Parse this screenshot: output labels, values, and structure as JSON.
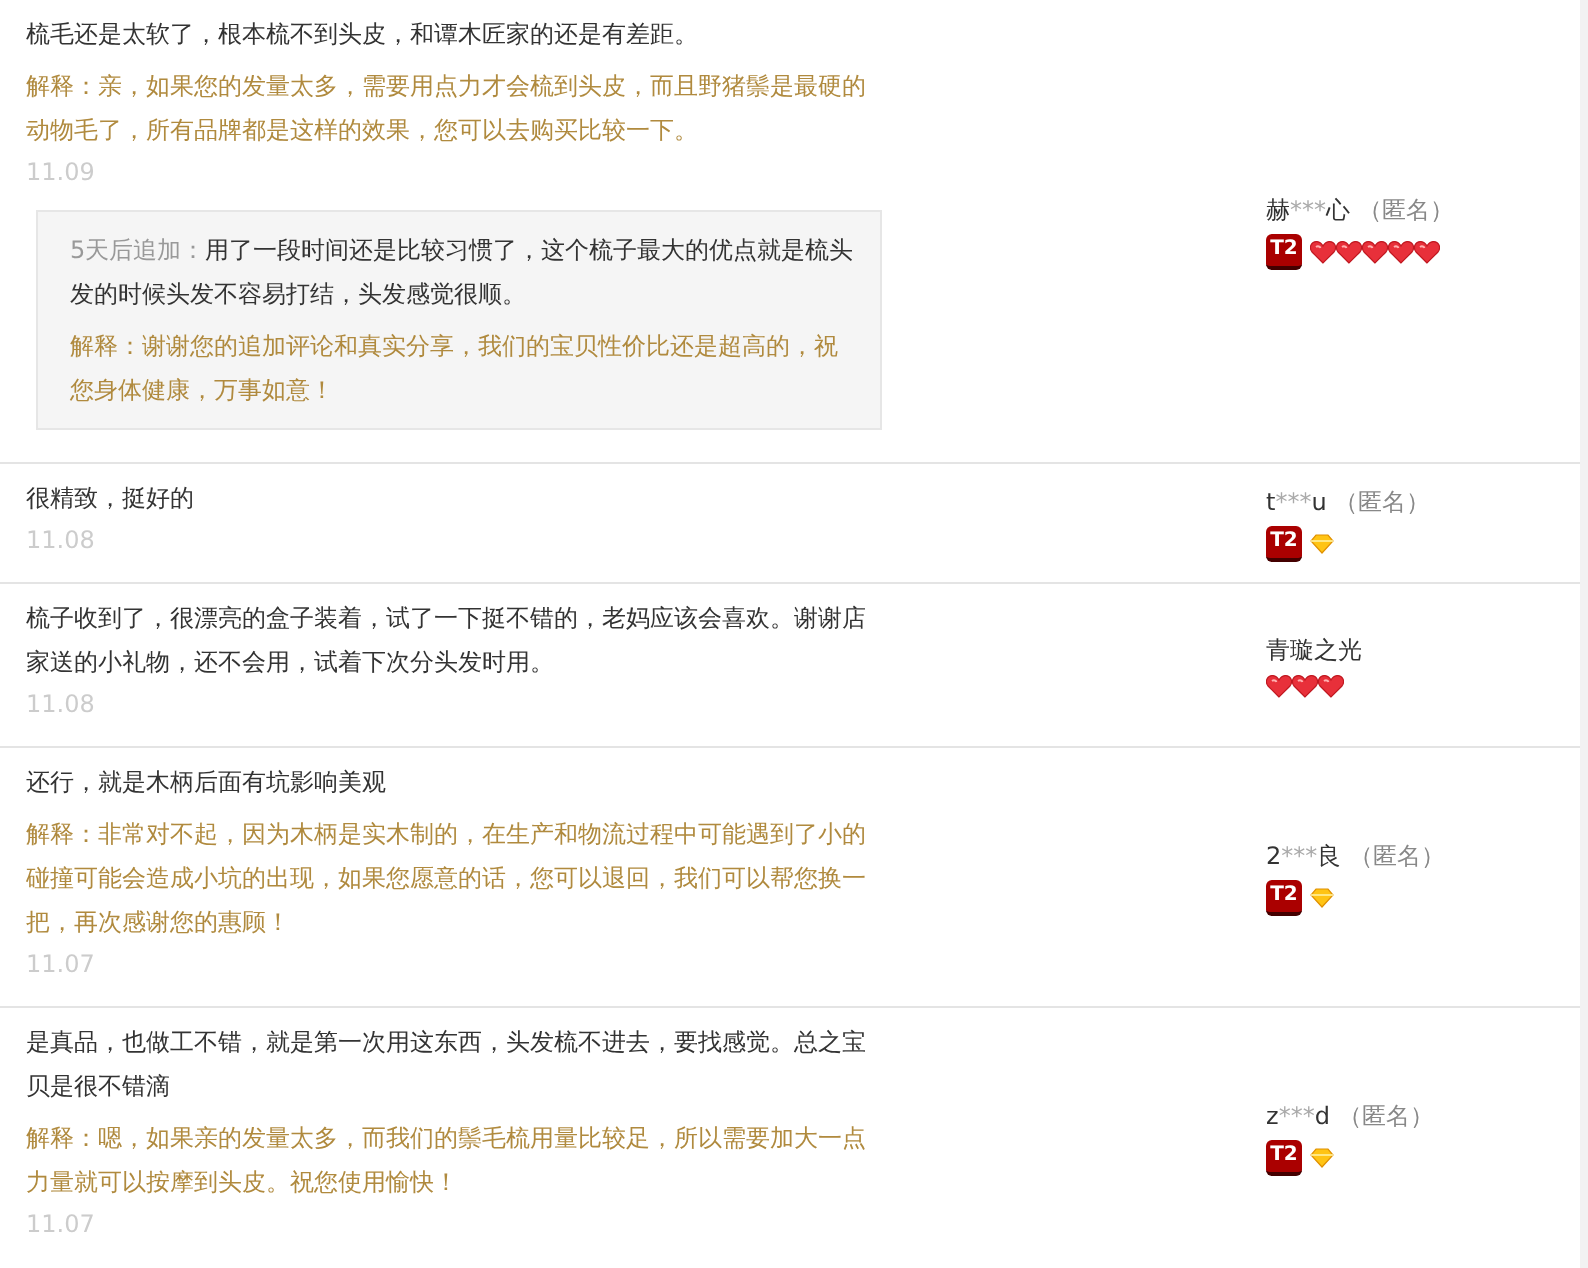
{
  "reviews": [
    {
      "text": "梳毛还是太软了，根本梳不到头皮，和谭木匠家的还是有差距。",
      "reply": "解释：亲，如果您的发量太多，需要用点力才会梳到头皮，而且野猪鬃是最硬的动物毛了，所有品牌都是这样的效果，您可以去购买比较一下。",
      "date": "11.09",
      "followup": {
        "label": "5天后追加：",
        "text": "用了一段时间还是比较习惯了，这个梳子最大的优点就是梳头发的时候头发不容易打结，头发感觉很顺。",
        "reply": "解释：谢谢您的追加评论和真实分享，我们的宝贝性价比还是超高的，祝您身体健康，万事如意！"
      },
      "user": {
        "first": "赫",
        "mask": "***",
        "last": "心",
        "anonymous": "（匿名）",
        "badge": "T2",
        "rank": [
          {
            "kind": "heart"
          },
          {
            "kind": "heart"
          },
          {
            "kind": "heart"
          },
          {
            "kind": "heart"
          },
          {
            "kind": "heart"
          }
        ]
      }
    },
    {
      "text": "很精致，挺好的",
      "date": "11.08",
      "user": {
        "first": "t",
        "mask": "***",
        "last": "u",
        "anonymous": "（匿名）",
        "badge": "T2",
        "rank": [
          {
            "kind": "diamond"
          }
        ]
      }
    },
    {
      "text": "梳子收到了，很漂亮的盒子装着，试了一下挺不错的，老妈应该会喜欢。谢谢店家送的小礼物，还不会用，试着下次分头发时用。",
      "date": "11.08",
      "user": {
        "first": "青璇之光",
        "rank": [
          {
            "kind": "heart"
          },
          {
            "kind": "heart"
          },
          {
            "kind": "heart"
          }
        ]
      }
    },
    {
      "text": "还行，就是木柄后面有坑影响美观",
      "reply": "解释：非常对不起，因为木柄是实木制的，在生产和物流过程中可能遇到了小的碰撞可能会造成小坑的出现，如果您愿意的话，您可以退回，我们可以帮您换一把，再次感谢您的惠顾！",
      "date": "11.07",
      "user": {
        "first": "2",
        "mask": "***",
        "last": "良",
        "anonymous": "（匿名）",
        "badge": "T2",
        "rank": [
          {
            "kind": "diamond"
          }
        ]
      }
    },
    {
      "text": "是真品，也做工不错，就是第一次用这东西，头发梳不进去，要找感觉。总之宝贝是很不错滴",
      "reply": "解释：嗯，如果亲的发量太多，而我们的鬃毛梳用量比较足，所以需要加大一点力量就可以按摩到头皮。祝您使用愉快！",
      "date": "11.07",
      "user": {
        "first": "z",
        "mask": "***",
        "last": "d",
        "anonymous": "（匿名）",
        "badge": "T2",
        "rank": [
          {
            "kind": "diamond"
          }
        ]
      }
    }
  ]
}
